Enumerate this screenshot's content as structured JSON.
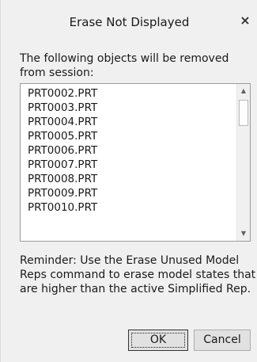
{
  "window": {
    "title": "Erase Not Displayed",
    "close_glyph": "×"
  },
  "dialog": {
    "intro_text": "The following objects will be removed from session:",
    "items": [
      "PRT0002.PRT",
      "PRT0003.PRT",
      "PRT0004.PRT",
      "PRT0005.PRT",
      "PRT0006.PRT",
      "PRT0007.PRT",
      "PRT0008.PRT",
      "PRT0009.PRT",
      "PRT0010.PRT"
    ],
    "reminder_text": "Reminder: Use the Erase Unused Model Reps command to erase model states that are higher than the active Simplified Rep."
  },
  "buttons": {
    "ok_label": "OK",
    "cancel_label": "Cancel"
  },
  "icons": {
    "close": "close-icon",
    "scroll_up": "scroll-up-icon",
    "scroll_down": "scroll-down-icon"
  }
}
